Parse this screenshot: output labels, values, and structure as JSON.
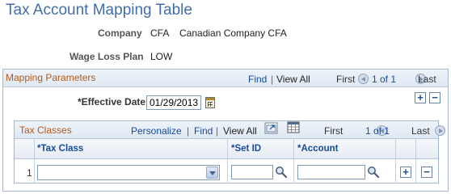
{
  "page": {
    "title": "Tax Account Mapping Table"
  },
  "header_fields": {
    "company_label": "Company",
    "company_code": "CFA",
    "company_name": "Canadian Company CFA",
    "wage_loss_plan_label": "Wage Loss Plan",
    "wage_loss_plan_value": "LOW"
  },
  "mapping_parameters": {
    "title": "Mapping Parameters",
    "find_link": "Find",
    "separator": "|",
    "view_all_link": "View All",
    "first_label": "First",
    "range_text": "1 of 1",
    "last_label": "Last",
    "effective_date_label": "*Effective Date",
    "effective_date_value": "01/29/2013",
    "add_row": "+",
    "delete_row": "−"
  },
  "tax_classes": {
    "title": "Tax Classes",
    "personalize_link": "Personalize",
    "find_link": "Find",
    "separator": "|",
    "view_all_link": "View All",
    "first_label": "First",
    "range_text": "1 of 1",
    "last_label": "Last",
    "columns": [
      "*Tax Class",
      "*Set ID",
      "*Account"
    ],
    "rows": [
      {
        "row_number": "1",
        "tax_class": "",
        "set_id": "",
        "account": "",
        "add_row": "+",
        "delete_row": "−"
      }
    ]
  },
  "colors": {
    "title_blue": "#416ea6",
    "link_blue": "#164b9c",
    "section_orange": "#b55a1a",
    "border": "#a4b7cd"
  },
  "icons": [
    "calendar-icon",
    "prev-arrow-icon",
    "next-arrow-icon",
    "zoom-icon",
    "grid-download-icon",
    "lookup-icon"
  ]
}
